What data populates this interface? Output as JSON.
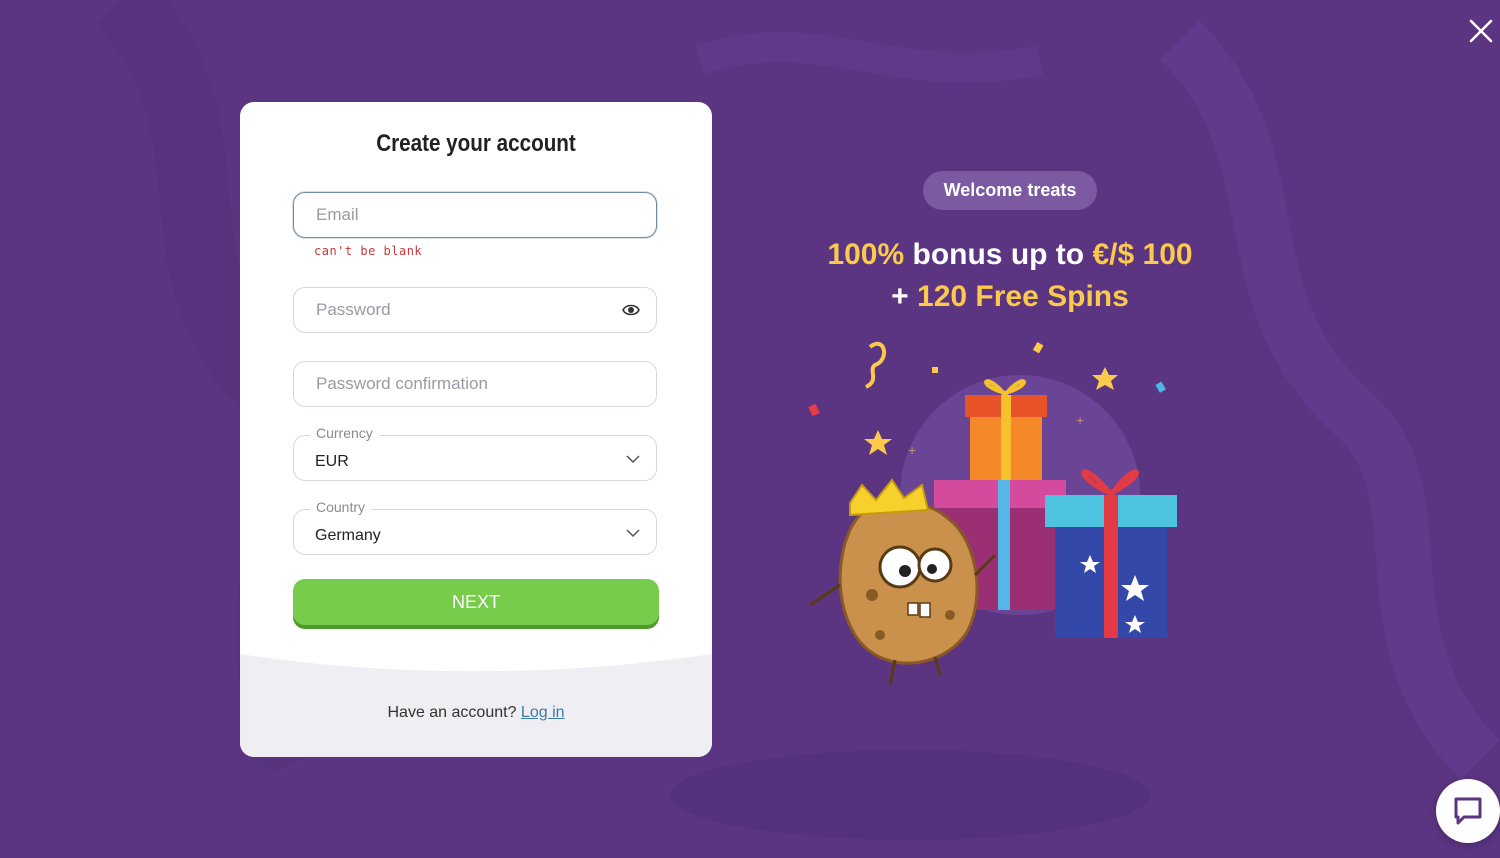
{
  "page": {
    "background_color": "#5b3582"
  },
  "close": {
    "icon": "close-icon"
  },
  "form": {
    "title": "Create your account",
    "email": {
      "placeholder": "Email",
      "value": "",
      "error": "can't be blank"
    },
    "password": {
      "placeholder": "Password",
      "value": "",
      "toggle_icon": "eye-icon"
    },
    "password_confirmation": {
      "placeholder": "Password confirmation",
      "value": ""
    },
    "currency": {
      "label": "Currency",
      "value": "EUR"
    },
    "country": {
      "label": "Country",
      "value": "Germany"
    },
    "next_label": "NEXT",
    "next_color": "#78cc4c",
    "footer": {
      "prompt": "Have an account?",
      "login_label": "Log in"
    }
  },
  "promo": {
    "pill": "Welcome treats",
    "line1_highlight_a": "100%",
    "line1_text": "bonus up to",
    "line1_highlight_b": "€/$ 100",
    "line2_text": "+",
    "line2_highlight": "120 Free Spins",
    "highlight_color": "#fbc94b"
  },
  "chat": {
    "icon": "chat-icon"
  }
}
